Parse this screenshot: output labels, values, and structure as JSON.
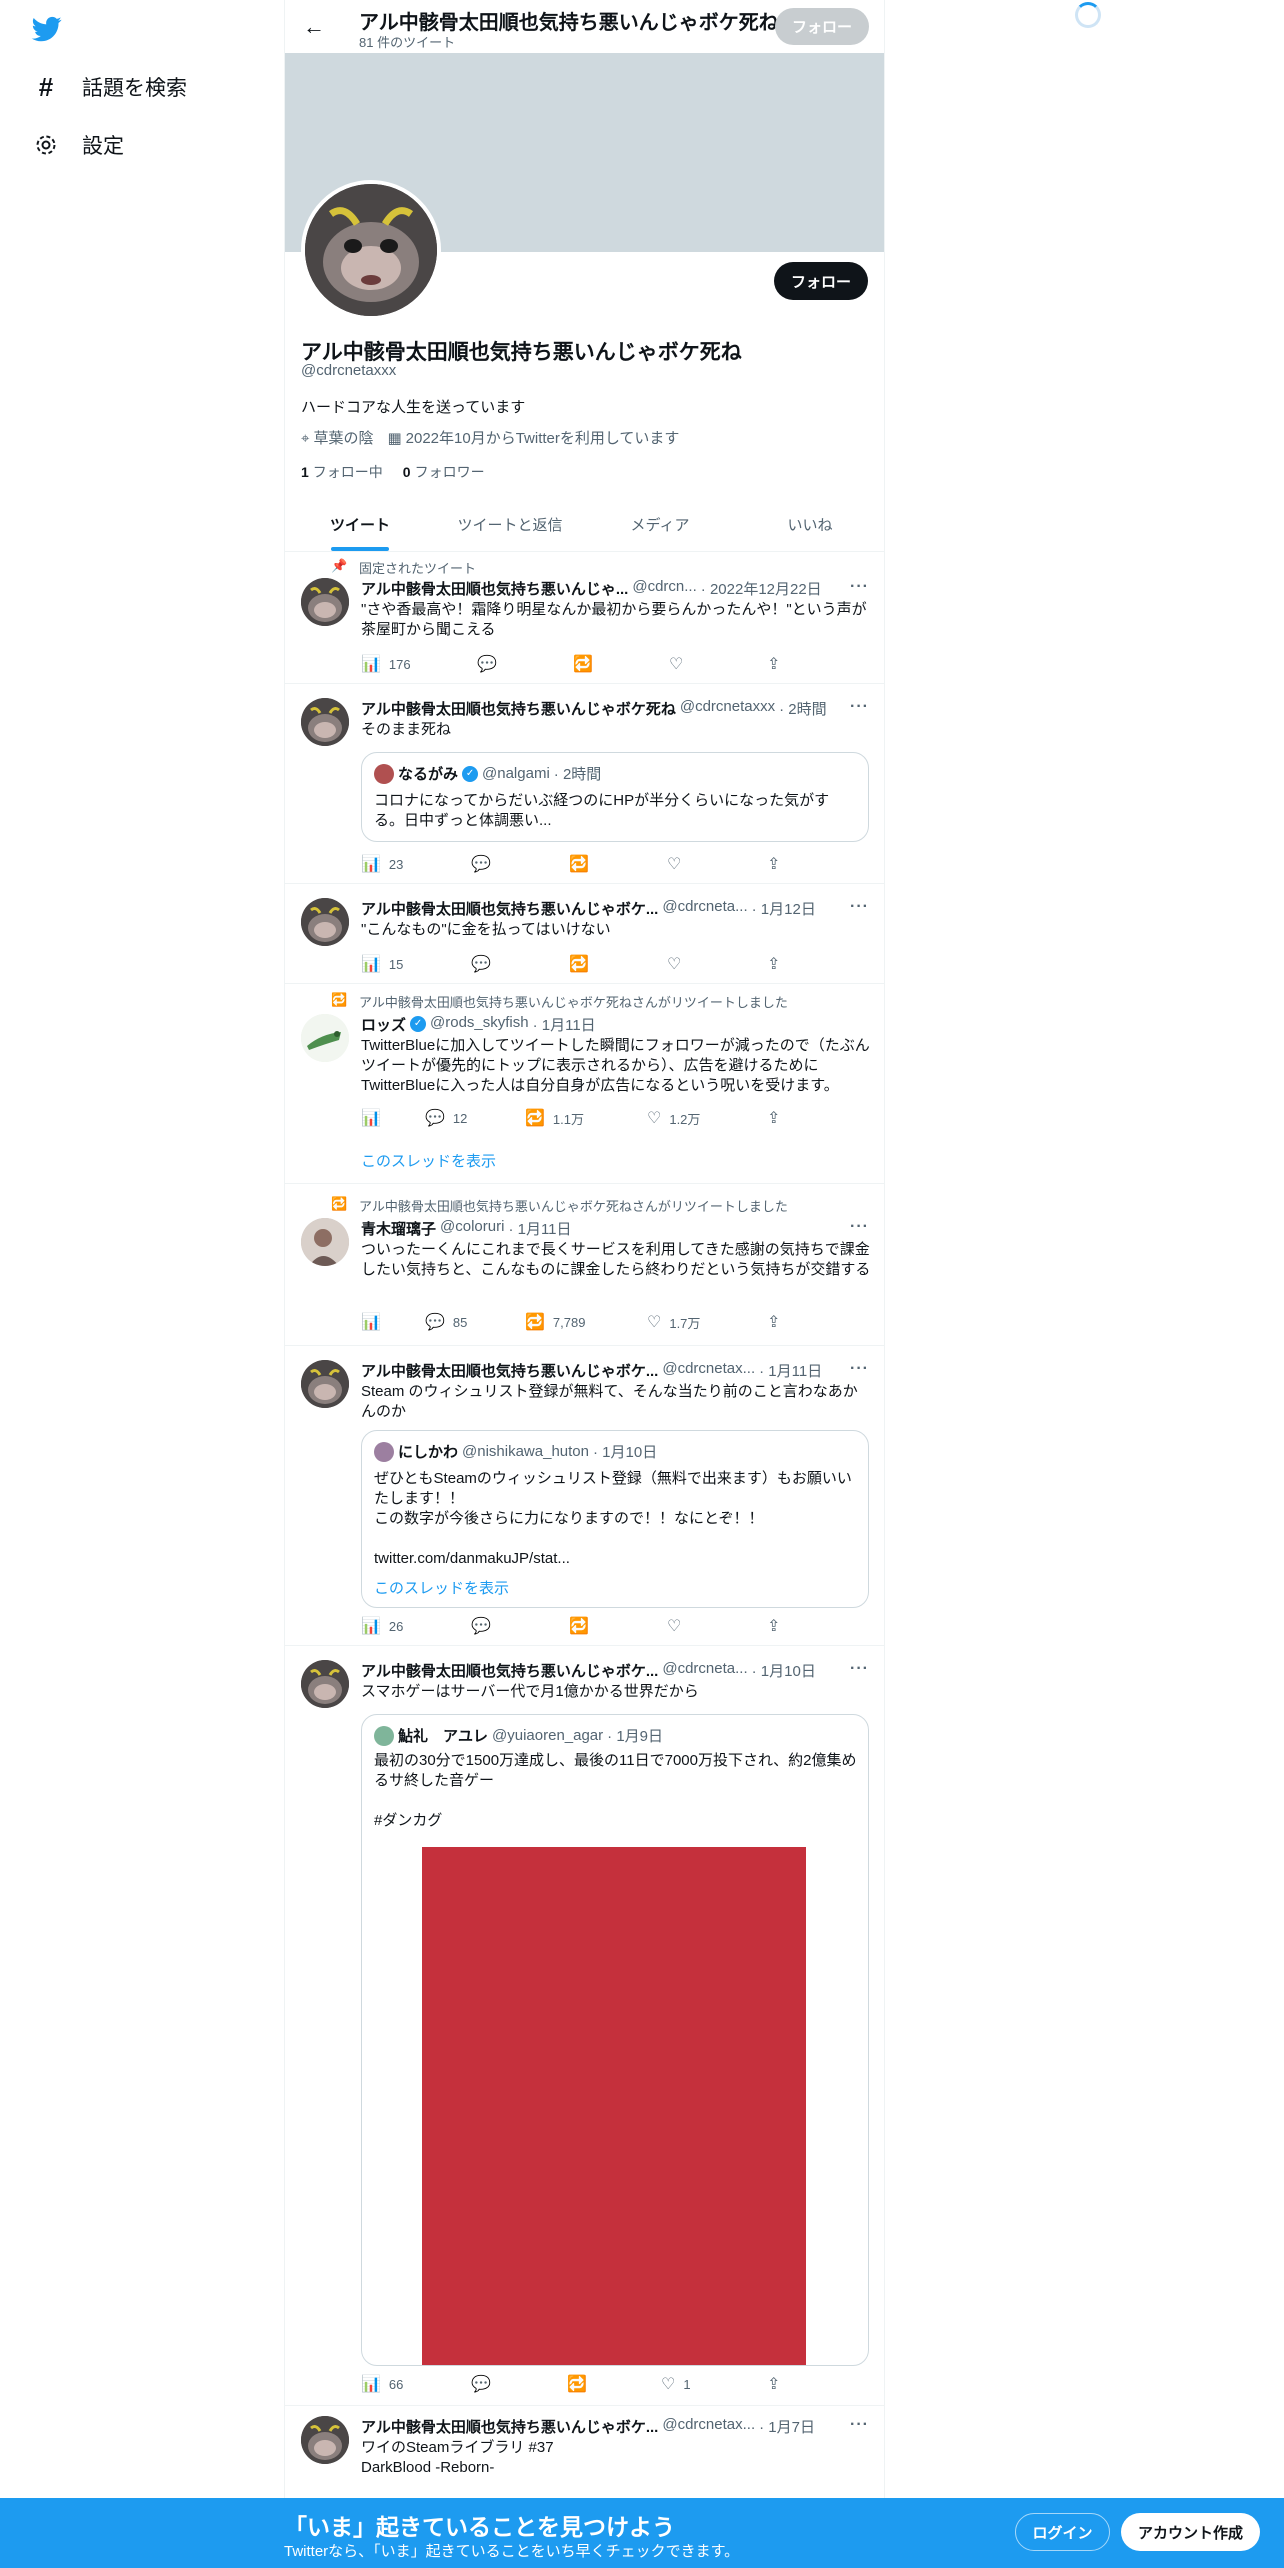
{
  "nav": {
    "explore_label": "話題を検索",
    "settings_label": "設定"
  },
  "header": {
    "title": "アル中骸骨太田順也気持ち悪いんじゃボケ死ね",
    "tweet_count": "81 件のツイート",
    "follow_label": "フォロー"
  },
  "profile": {
    "name": "アル中骸骨太田順也気持ち悪いんじゃボケ死ね",
    "handle": "@cdrcnetaxxx",
    "bio": "ハードコアな人生を送っています",
    "location": "草葉の陰",
    "joined": "2022年10月からTwitterを利用しています",
    "following_count": "1",
    "following_label": "フォロー中",
    "followers_count": "0",
    "followers_label": "フォロワー",
    "follow_label": "フォロー"
  },
  "tabs": [
    "ツイート",
    "ツイートと返信",
    "メディア",
    "いいね"
  ],
  "tweets": [
    {
      "context": "固定されたツイート",
      "name": "アル中骸骨太田順也気持ち悪いんじゃ...",
      "handle": "@cdrcn...",
      "time": "· 2022年12月22日",
      "text": "\"さや香最高や！霜降り明星なんか最初から要らんかったんや！\"という声が茶屋町から聞こえる",
      "views": "176",
      "replies": "",
      "retweets": "",
      "likes": ""
    },
    {
      "name": "アル中骸骨太田順也気持ち悪いんじゃボケ死ね",
      "handle": "@cdrcnetaxxx",
      "time": "· 2時間",
      "text": "そのまま死ね",
      "quote": {
        "name": "なるがみ",
        "handle": "@nalgami",
        "time": "· 2時間",
        "text": "コロナになってからだいぶ経つのにHPが半分くらいになった気がする。日中ずっと体調悪い..."
      },
      "views": "23"
    },
    {
      "name": "アル中骸骨太田順也気持ち悪いんじゃボケ...",
      "handle": "@cdrcneta...",
      "time": "· 1月12日",
      "text": "\"こんなもの\"に金を払ってはいけない",
      "views": "15"
    },
    {
      "context": "アル中骸骨太田順也気持ち悪いんじゃボケ死ねさんがリツイートしました",
      "name": "ロッズ",
      "handle": "@rods_skyfish",
      "time": "· 1月11日",
      "text": "TwitterBlueに加入してツイートした瞬間にフォロワーが減ったので（たぶんツイートが優先的にトップに表示されるから）、広告を避けるためにTwitterBlueに入った人は自分自身が広告になるという呪いを受けます。",
      "replies": "12",
      "retweets": "1.1万",
      "likes": "1.2万",
      "thread_label": "このスレッドを表示"
    },
    {
      "context": "アル中骸骨太田順也気持ち悪いんじゃボケ死ねさんがリツイートしました",
      "name": "青木瑠璃子",
      "handle": "@coloruri",
      "time": "· 1月11日",
      "text": "ついったーくんにこれまで長くサービスを利用してきた感謝の気持ちで課金したい気持ちと、こんなものに課金したら終わりだという気持ちが交錯する",
      "replies": "85",
      "retweets": "7,789",
      "likes": "1.7万"
    },
    {
      "name": "アル中骸骨太田順也気持ち悪いんじゃボケ...",
      "handle": "@cdrcnetax...",
      "time": "· 1月11日",
      "text": "Steam のウィシュリスト登録が無料て、そんな当たり前のこと言わなあかんのか",
      "quote": {
        "name": "にしかわ",
        "handle": "@nishikawa_huton",
        "time": "· 1月10日",
        "text": "ぜひともSteamのウィッシュリスト登録（無料で出来ます）もお願いいたします！！\nこの数字が今後さらに力になりますので！！なにとぞ！！\n\ntwitter.com/danmakuJP/stat...",
        "thread_label": "このスレッドを表示"
      },
      "views": "26"
    },
    {
      "name": "アル中骸骨太田順也気持ち悪いんじゃボケ...",
      "handle": "@cdrcneta...",
      "time": "· 1月10日",
      "text": "スマホゲーはサーバー代で月1億かかる世界だから",
      "quote": {
        "name": "鮎礼　アユレ",
        "handle": "@yuiaoren_agar",
        "time": "· 1月9日",
        "text": "最初の30分で1500万達成し、最後の11日で7000万投下され、約2億集めるサ終した音ゲー\n\n#ダンカグ",
        "image_color": "#c5303c"
      },
      "views": "66",
      "likes": "1"
    },
    {
      "name": "アル中骸骨太田順也気持ち悪いんじゃボケ...",
      "handle": "@cdrcnetax...",
      "time": "· 1月7日",
      "text": "ワイのSteamライブラリ #37\nDarkBlood -Reborn-"
    }
  ],
  "bottom": {
    "title": "「いま」起きていることを見つけよう",
    "subtitle": "Twitterなら、「いま」起きていることをいち早くチェックできます。",
    "login_label": "ログイン",
    "signup_label": "アカウント作成"
  },
  "colors": {
    "accent": "#1d9bf0",
    "text": "#0f1419",
    "secondary": "#536471"
  }
}
